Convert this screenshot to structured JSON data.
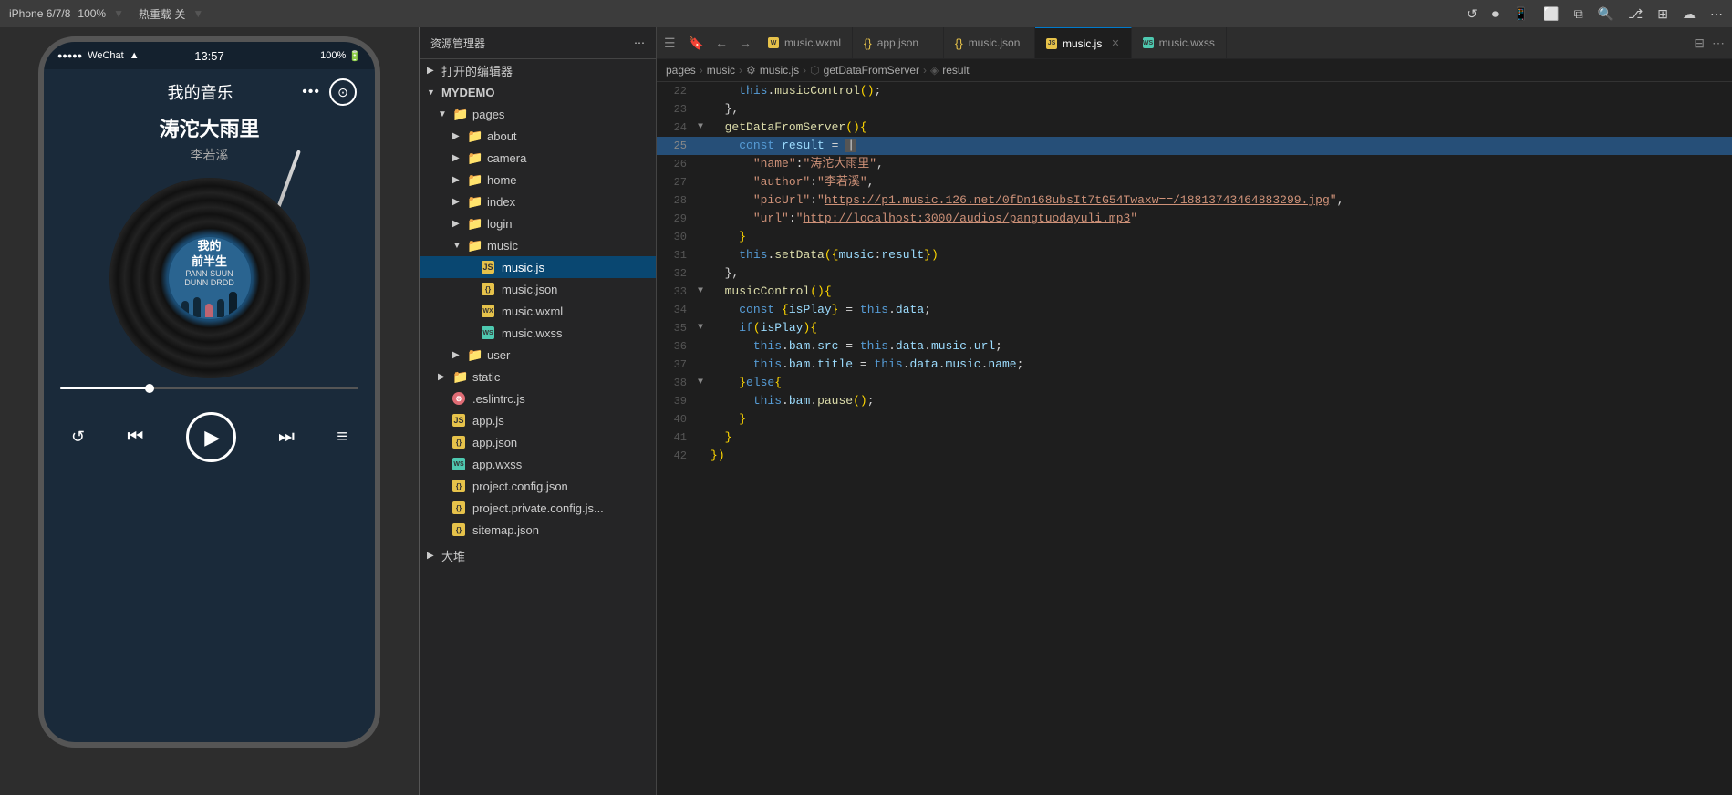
{
  "topbar": {
    "device": "iPhone 6/7/8",
    "scale": "100%",
    "hotreload": "热重载 关",
    "icons": [
      "refresh",
      "record",
      "phone",
      "window",
      "copy",
      "search",
      "branch",
      "extensions",
      "deploy"
    ]
  },
  "sidebar": {
    "title": "资源管理器",
    "open_editors_label": "打开的编辑器",
    "root_label": "MYDEMO",
    "tree": [
      {
        "id": "pages",
        "label": "pages",
        "level": 1,
        "type": "folder",
        "open": true,
        "arrow": "▼"
      },
      {
        "id": "about",
        "label": "about",
        "level": 2,
        "type": "folder",
        "open": false,
        "arrow": "▶"
      },
      {
        "id": "camera",
        "label": "camera",
        "level": 2,
        "type": "folder",
        "open": false,
        "arrow": "▶"
      },
      {
        "id": "home",
        "label": "home",
        "level": 2,
        "type": "folder",
        "open": false,
        "arrow": "▶"
      },
      {
        "id": "index",
        "label": "index",
        "level": 2,
        "type": "folder",
        "open": false,
        "arrow": "▶"
      },
      {
        "id": "login",
        "label": "login",
        "level": 2,
        "type": "folder",
        "open": false,
        "arrow": "▶"
      },
      {
        "id": "music",
        "label": "music",
        "level": 2,
        "type": "folder",
        "open": true,
        "arrow": "▼"
      },
      {
        "id": "music_js",
        "label": "music.js",
        "level": 3,
        "type": "js",
        "active": true
      },
      {
        "id": "music_json",
        "label": "music.json",
        "level": 3,
        "type": "json"
      },
      {
        "id": "music_wxml",
        "label": "music.wxml",
        "level": 3,
        "type": "wxml"
      },
      {
        "id": "music_wxss",
        "label": "music.wxss",
        "level": 3,
        "type": "wxss"
      },
      {
        "id": "user",
        "label": "user",
        "level": 2,
        "type": "folder",
        "open": false,
        "arrow": "▶"
      },
      {
        "id": "static",
        "label": "static",
        "level": 1,
        "type": "folder",
        "open": false,
        "arrow": "▶"
      },
      {
        "id": "eslintrc",
        "label": ".eslintrc.js",
        "level": 1,
        "type": "js_config"
      },
      {
        "id": "app_js",
        "label": "app.js",
        "level": 1,
        "type": "js"
      },
      {
        "id": "app_json",
        "label": "app.json",
        "level": 1,
        "type": "json"
      },
      {
        "id": "app_wxss",
        "label": "app.wxss",
        "level": 1,
        "type": "wxss"
      },
      {
        "id": "project_config",
        "label": "project.config.json",
        "level": 1,
        "type": "json"
      },
      {
        "id": "project_private",
        "label": "project.private.config.js...",
        "level": 1,
        "type": "json"
      },
      {
        "id": "sitemap",
        "label": "sitemap.json",
        "level": 1,
        "type": "json"
      }
    ]
  },
  "tabs": [
    {
      "id": "music_wxml_tab",
      "label": "music.wxml",
      "type": "wxml",
      "active": false
    },
    {
      "id": "app_json_tab",
      "label": "app.json",
      "type": "json",
      "active": false
    },
    {
      "id": "music_json_tab",
      "label": "music.json",
      "type": "json",
      "active": false
    },
    {
      "id": "music_js_tab",
      "label": "music.js",
      "type": "js",
      "active": true,
      "closeable": true
    },
    {
      "id": "music_wxss_tab",
      "label": "music.wxss",
      "type": "wxss",
      "active": false
    }
  ],
  "breadcrumb": {
    "items": [
      "pages",
      "music",
      "music.js",
      "getDataFromServer",
      "result"
    ]
  },
  "code": {
    "lines": [
      {
        "num": 22,
        "fold": false,
        "text": "    this.musicControl();"
      },
      {
        "num": 23,
        "fold": false,
        "text": "  },"
      },
      {
        "num": 24,
        "fold": true,
        "text": "  getDataFromServer(){"
      },
      {
        "num": 25,
        "fold": false,
        "text": "    const result = "
      },
      {
        "num": 26,
        "fold": false,
        "text": "      \"name\":\"涛沱大雨里\","
      },
      {
        "num": 27,
        "fold": false,
        "text": "      \"author\":\"李若溪\","
      },
      {
        "num": 28,
        "fold": false,
        "text": "      \"picUrl\":\"https://p1.music.126.net/0fDn168ubsIt7tG54Twaxw==/18813743464883299.jpg\","
      },
      {
        "num": 29,
        "fold": false,
        "text": "      \"url\":\"http://localhost:3000/audios/pangtuodayuli.mp3\""
      },
      {
        "num": 30,
        "fold": false,
        "text": "    }"
      },
      {
        "num": 31,
        "fold": false,
        "text": "    this.setData({music:result})"
      },
      {
        "num": 32,
        "fold": false,
        "text": "  },"
      },
      {
        "num": 33,
        "fold": true,
        "text": "  musicControl(){"
      },
      {
        "num": 34,
        "fold": false,
        "text": "    const {isPlay} = this.data;"
      },
      {
        "num": 35,
        "fold": true,
        "text": "    if(isPlay){"
      },
      {
        "num": 36,
        "fold": false,
        "text": "      this.bam.src = this.data.music.url;"
      },
      {
        "num": 37,
        "fold": false,
        "text": "      this.bam.title = this.data.music.name;"
      },
      {
        "num": 38,
        "fold": true,
        "text": "    }else{"
      },
      {
        "num": 39,
        "fold": false,
        "text": "      this.bam.pause();"
      },
      {
        "num": 40,
        "fold": false,
        "text": "    }"
      },
      {
        "num": 41,
        "fold": false,
        "text": "  }"
      },
      {
        "num": 42,
        "fold": false,
        "text": "})"
      }
    ]
  },
  "phone": {
    "status_time": "13:57",
    "battery": "100%",
    "signal": "●●●●●",
    "wechat": "WeChat",
    "wifi": "WiFi",
    "title": "我的音乐",
    "song_name": "涛沱大雨里",
    "artist": "李若溪",
    "vinyl_title": "我的",
    "vinyl_subtitle": "前半生",
    "vinyl_sub2": "PANN SUUN",
    "vinyl_sub3": "DUNN DRDD"
  }
}
